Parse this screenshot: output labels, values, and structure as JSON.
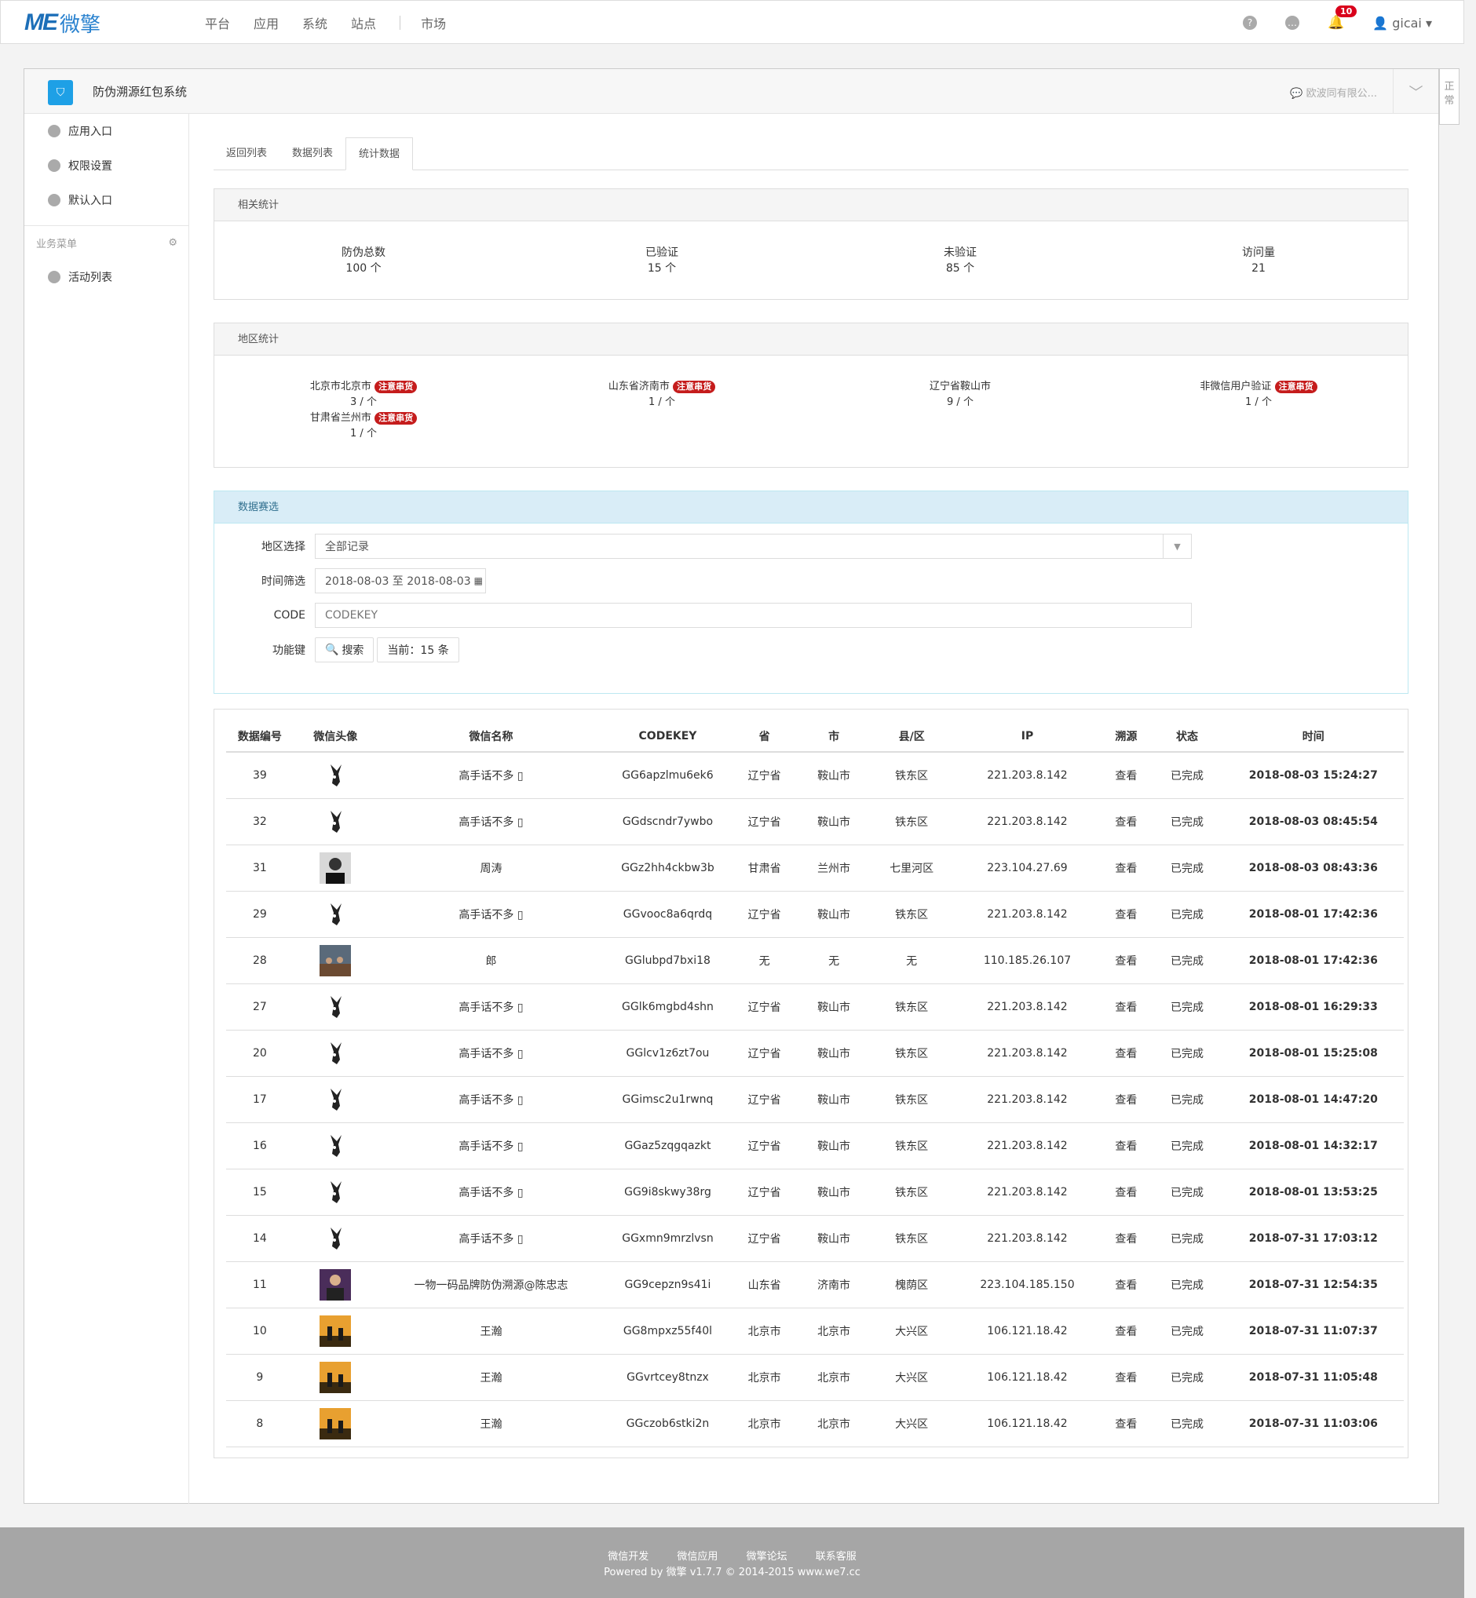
{
  "nav": {
    "logo_me": "ME",
    "logo_cn": "微擎",
    "links": [
      "平台",
      "应用",
      "系统",
      "站点",
      "市场"
    ],
    "notify_count": "10",
    "username": "gicai"
  },
  "app": {
    "title": "防伪溯源红包系统",
    "account": "欧波同有限公...",
    "sidetab": "正常"
  },
  "sidebar": {
    "items": [
      "应用入口",
      "权限设置",
      "默认入口"
    ],
    "group": "业务菜单",
    "group_items": [
      "活动列表"
    ]
  },
  "tabs": [
    "返回列表",
    "数据列表",
    "统计数据"
  ],
  "stats": {
    "header": "相关统计",
    "items": [
      {
        "label": "防伪总数",
        "value": "100 个"
      },
      {
        "label": "已验证",
        "value": "15 个"
      },
      {
        "label": "未验证",
        "value": "85 个"
      },
      {
        "label": "访问量",
        "value": "21"
      }
    ]
  },
  "regions": {
    "header": "地区统计",
    "tag": "注意串货",
    "items": [
      {
        "name": "北京市北京市",
        "count": "3 / 个",
        "tag": true
      },
      {
        "name": "山东省济南市",
        "count": "1 / 个",
        "tag": true
      },
      {
        "name": "辽宁省鞍山市",
        "count": "9 / 个",
        "tag": false
      },
      {
        "name": "非微信用户验证",
        "count": "1 / 个",
        "tag": true
      },
      {
        "name": "甘肃省兰州市",
        "count": "1 / 个",
        "tag": true
      }
    ]
  },
  "filter": {
    "header": "数据赛选",
    "region_label": "地区选择",
    "region_value": "全部记录",
    "time_label": "时间筛选",
    "time_value": "2018-08-03 至 2018-08-03",
    "code_label": "CODE",
    "code_placeholder": "CODEKEY",
    "func_label": "功能键",
    "search_btn": "搜索",
    "current_btn": "当前：15 条"
  },
  "table": {
    "headers": [
      "数据编号",
      "微信头像",
      "微信名称",
      "CODEKEY",
      "省",
      "市",
      "县/区",
      "IP",
      "溯源",
      "状态",
      "时间"
    ],
    "rows": [
      {
        "id": "39",
        "avatar": "rabbit",
        "name": "高手话不多 ▯",
        "code": "GG6apzlmu6ek6",
        "prov": "辽宁省",
        "city": "鞍山市",
        "dist": "铁东区",
        "ip": "221.203.8.142",
        "trace": "查看",
        "status": "已完成",
        "time": "2018-08-03 15:24:27"
      },
      {
        "id": "32",
        "avatar": "rabbit",
        "name": "高手话不多 ▯",
        "code": "GGdscndr7ywbo",
        "prov": "辽宁省",
        "city": "鞍山市",
        "dist": "铁东区",
        "ip": "221.203.8.142",
        "trace": "查看",
        "status": "已完成",
        "time": "2018-08-03 08:45:54"
      },
      {
        "id": "31",
        "avatar": "man",
        "name": "周涛",
        "code": "GGz2hh4ckbw3b",
        "prov": "甘肃省",
        "city": "兰州市",
        "dist": "七里河区",
        "ip": "223.104.27.69",
        "trace": "查看",
        "status": "已完成",
        "time": "2018-08-03 08:43:36"
      },
      {
        "id": "29",
        "avatar": "rabbit",
        "name": "高手话不多 ▯",
        "code": "GGvooc8a6qrdq",
        "prov": "辽宁省",
        "city": "鞍山市",
        "dist": "铁东区",
        "ip": "221.203.8.142",
        "trace": "查看",
        "status": "已完成",
        "time": "2018-08-01 17:42:36"
      },
      {
        "id": "28",
        "avatar": "group",
        "name": "郎",
        "code": "GGlubpd7bxi18",
        "prov": "无",
        "city": "无",
        "dist": "无",
        "ip": "110.185.26.107",
        "trace": "查看",
        "status": "已完成",
        "time": "2018-08-01 17:42:36"
      },
      {
        "id": "27",
        "avatar": "rabbit",
        "name": "高手话不多 ▯",
        "code": "GGlk6mgbd4shn",
        "prov": "辽宁省",
        "city": "鞍山市",
        "dist": "铁东区",
        "ip": "221.203.8.142",
        "trace": "查看",
        "status": "已完成",
        "time": "2018-08-01 16:29:33"
      },
      {
        "id": "20",
        "avatar": "rabbit",
        "name": "高手话不多 ▯",
        "code": "GGlcv1z6zt7ou",
        "prov": "辽宁省",
        "city": "鞍山市",
        "dist": "铁东区",
        "ip": "221.203.8.142",
        "trace": "查看",
        "status": "已完成",
        "time": "2018-08-01 15:25:08"
      },
      {
        "id": "17",
        "avatar": "rabbit",
        "name": "高手话不多 ▯",
        "code": "GGimsc2u1rwnq",
        "prov": "辽宁省",
        "city": "鞍山市",
        "dist": "铁东区",
        "ip": "221.203.8.142",
        "trace": "查看",
        "status": "已完成",
        "time": "2018-08-01 14:47:20"
      },
      {
        "id": "16",
        "avatar": "rabbit",
        "name": "高手话不多 ▯",
        "code": "GGaz5zqgqazkt",
        "prov": "辽宁省",
        "city": "鞍山市",
        "dist": "铁东区",
        "ip": "221.203.8.142",
        "trace": "查看",
        "status": "已完成",
        "time": "2018-08-01 14:32:17"
      },
      {
        "id": "15",
        "avatar": "rabbit",
        "name": "高手话不多 ▯",
        "code": "GG9i8skwy38rg",
        "prov": "辽宁省",
        "city": "鞍山市",
        "dist": "铁东区",
        "ip": "221.203.8.142",
        "trace": "查看",
        "status": "已完成",
        "time": "2018-08-01 13:53:25"
      },
      {
        "id": "14",
        "avatar": "rabbit",
        "name": "高手话不多 ▯",
        "code": "GGxmn9mrzlvsn",
        "prov": "辽宁省",
        "city": "鞍山市",
        "dist": "铁东区",
        "ip": "221.203.8.142",
        "trace": "查看",
        "status": "已完成",
        "time": "2018-07-31 17:03:12"
      },
      {
        "id": "11",
        "avatar": "suit",
        "name": "一物一码品牌防伪溯源@陈忠志",
        "code": "GG9cepzn9s41i",
        "prov": "山东省",
        "city": "济南市",
        "dist": "槐荫区",
        "ip": "223.104.185.150",
        "trace": "查看",
        "status": "已完成",
        "time": "2018-07-31 12:54:35"
      },
      {
        "id": "10",
        "avatar": "sunset",
        "name": "王瀚",
        "code": "GG8mpxz55f40l",
        "prov": "北京市",
        "city": "北京市",
        "dist": "大兴区",
        "ip": "106.121.18.42",
        "trace": "查看",
        "status": "已完成",
        "time": "2018-07-31 11:07:37"
      },
      {
        "id": "9",
        "avatar": "sunset",
        "name": "王瀚",
        "code": "GGvrtcey8tnzx",
        "prov": "北京市",
        "city": "北京市",
        "dist": "大兴区",
        "ip": "106.121.18.42",
        "trace": "查看",
        "status": "已完成",
        "time": "2018-07-31 11:05:48"
      },
      {
        "id": "8",
        "avatar": "sunset",
        "name": "王瀚",
        "code": "GGczob6stki2n",
        "prov": "北京市",
        "city": "北京市",
        "dist": "大兴区",
        "ip": "106.121.18.42",
        "trace": "查看",
        "status": "已完成",
        "time": "2018-07-31 11:03:06"
      }
    ]
  },
  "footer": {
    "links": [
      "微信开发",
      "微信应用",
      "微擎论坛",
      "联系客服"
    ],
    "powered": "Powered by 微擎 v1.7.7 © 2014-2015 www.we7.cc"
  }
}
